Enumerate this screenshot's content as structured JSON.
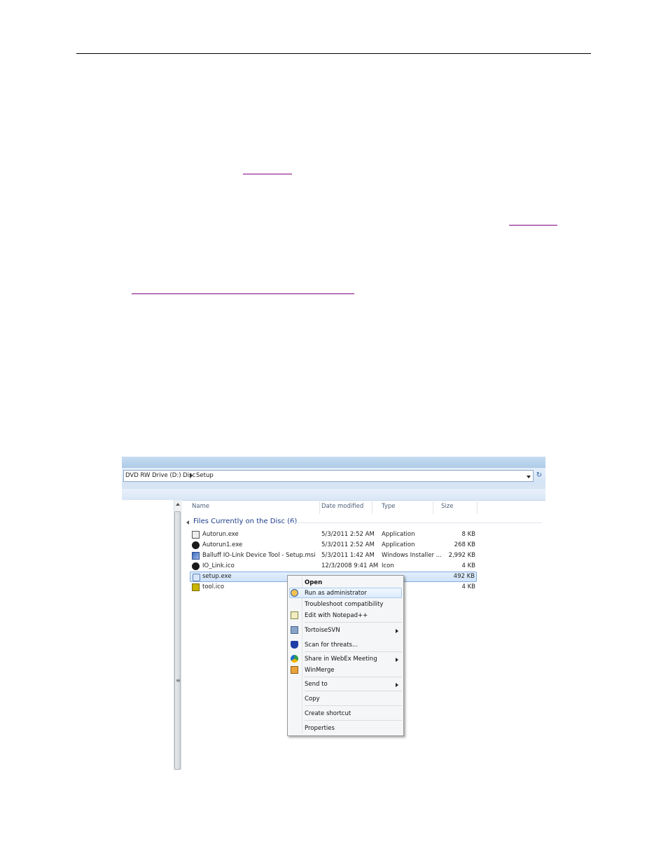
{
  "explorer": {
    "address": {
      "crumb_drive": "DVD RW Drive (D:) Disc",
      "crumb_folder": "Setup"
    },
    "columns": {
      "name": "Name",
      "date": "Date modified",
      "type": "Type",
      "size": "Size"
    },
    "group_title": "Files Currently on the Disc (6)",
    "files": [
      {
        "name": "Autorun.exe",
        "date": "5/3/2011 2:52 AM",
        "type": "Application",
        "size": "8 KB",
        "icon": "application-icon"
      },
      {
        "name": "Autorun1.exe",
        "date": "5/3/2011 2:52 AM",
        "type": "Application",
        "size": "268 KB",
        "icon": "autorun-ball-icon"
      },
      {
        "name": "Balluff IO-Link Device Tool - Setup.msi",
        "date": "5/3/2011 1:42 AM",
        "type": "Windows Installer ...",
        "size": "2,992 KB",
        "icon": "installer-icon"
      },
      {
        "name": "IO_Link.ico",
        "date": "12/3/2008 9:41 AM",
        "type": "Icon",
        "size": "4 KB",
        "icon": "io-link-ball-icon"
      },
      {
        "name": "setup.exe",
        "date": "",
        "type": "",
        "size": "492 KB",
        "icon": "setup-icon"
      },
      {
        "name": "tool.ico",
        "date": "",
        "type": "",
        "size": "4 KB",
        "icon": "tool-icon"
      }
    ],
    "context_menu": {
      "open": "Open",
      "run_as_admin": "Run as administrator",
      "troubleshoot": "Troubleshoot compatibility",
      "edit_notepad": "Edit with Notepad++",
      "tortoise": "TortoiseSVN",
      "scan": "Scan for threats...",
      "webex": "Share in WebEx Meeting",
      "winmerge": "WinMerge",
      "send_to": "Send to",
      "copy": "Copy",
      "create_shortcut": "Create shortcut",
      "properties": "Properties"
    }
  },
  "colors": {
    "link_visited": "#800080",
    "selection_border": "#84acdd",
    "group_header": "#1e3e8a"
  }
}
